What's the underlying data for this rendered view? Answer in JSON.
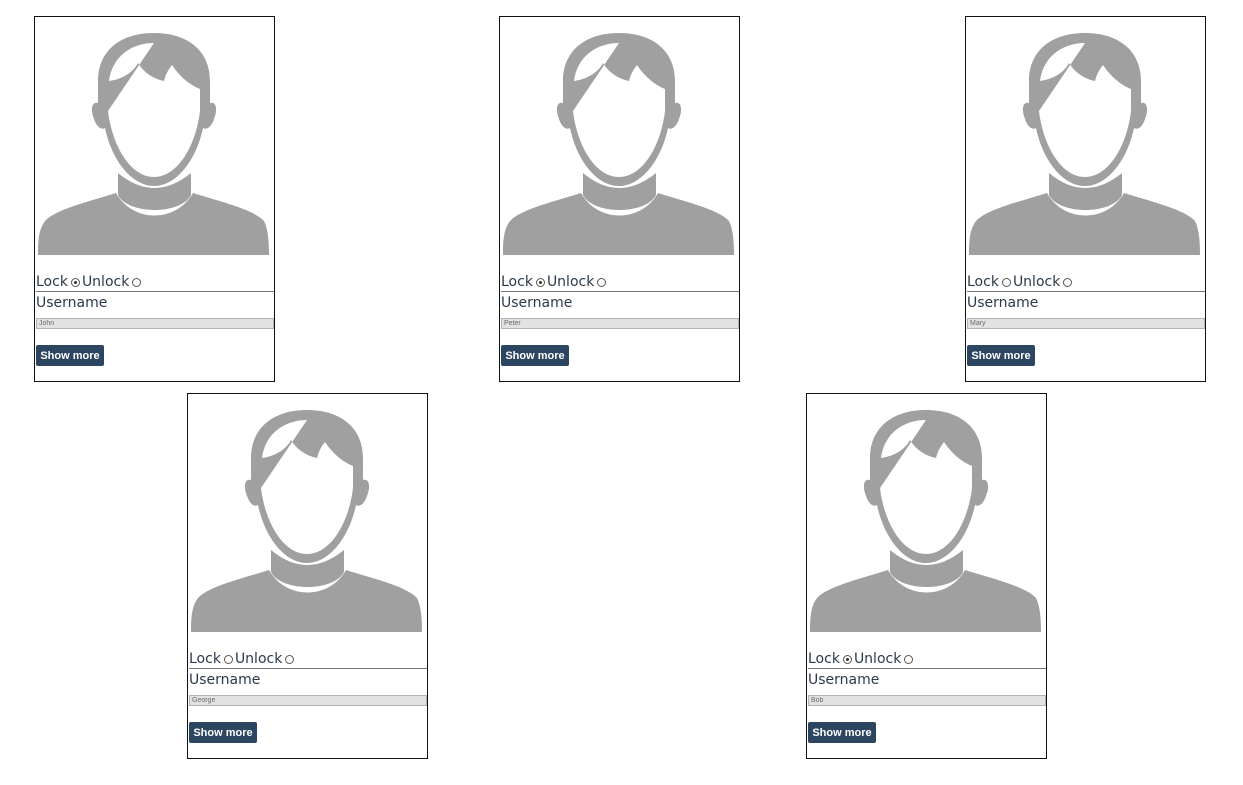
{
  "users": [
    {
      "lock_label": "Lock",
      "unlock_label": "Unlock",
      "username_label": "Username",
      "username_value": "John",
      "lock_selected": true,
      "button_label": "Show more",
      "avatar_icon": "user-silhouette-icon"
    },
    {
      "lock_label": "Lock",
      "unlock_label": "Unlock",
      "username_label": "Username",
      "username_value": "Peter",
      "lock_selected": true,
      "button_label": "Show more",
      "avatar_icon": "user-silhouette-icon"
    },
    {
      "lock_label": "Lock",
      "unlock_label": "Unlock",
      "username_label": "Username",
      "username_value": "Mary",
      "lock_selected": false,
      "button_label": "Show more",
      "avatar_icon": "user-silhouette-icon"
    },
    {
      "lock_label": "Lock",
      "unlock_label": "Unlock",
      "username_label": "Username",
      "username_value": "George",
      "lock_selected": false,
      "button_label": "Show more",
      "avatar_icon": "user-silhouette-icon"
    },
    {
      "lock_label": "Lock",
      "unlock_label": "Unlock",
      "username_label": "Username",
      "username_value": "Bob",
      "lock_selected": true,
      "button_label": "Show more",
      "avatar_icon": "user-silhouette-icon"
    }
  ],
  "colors": {
    "avatar_gray": "#a0a0a0",
    "button_bg": "#2c4560",
    "text": "#2b3a4a",
    "input_bg": "#e2e2e2"
  }
}
